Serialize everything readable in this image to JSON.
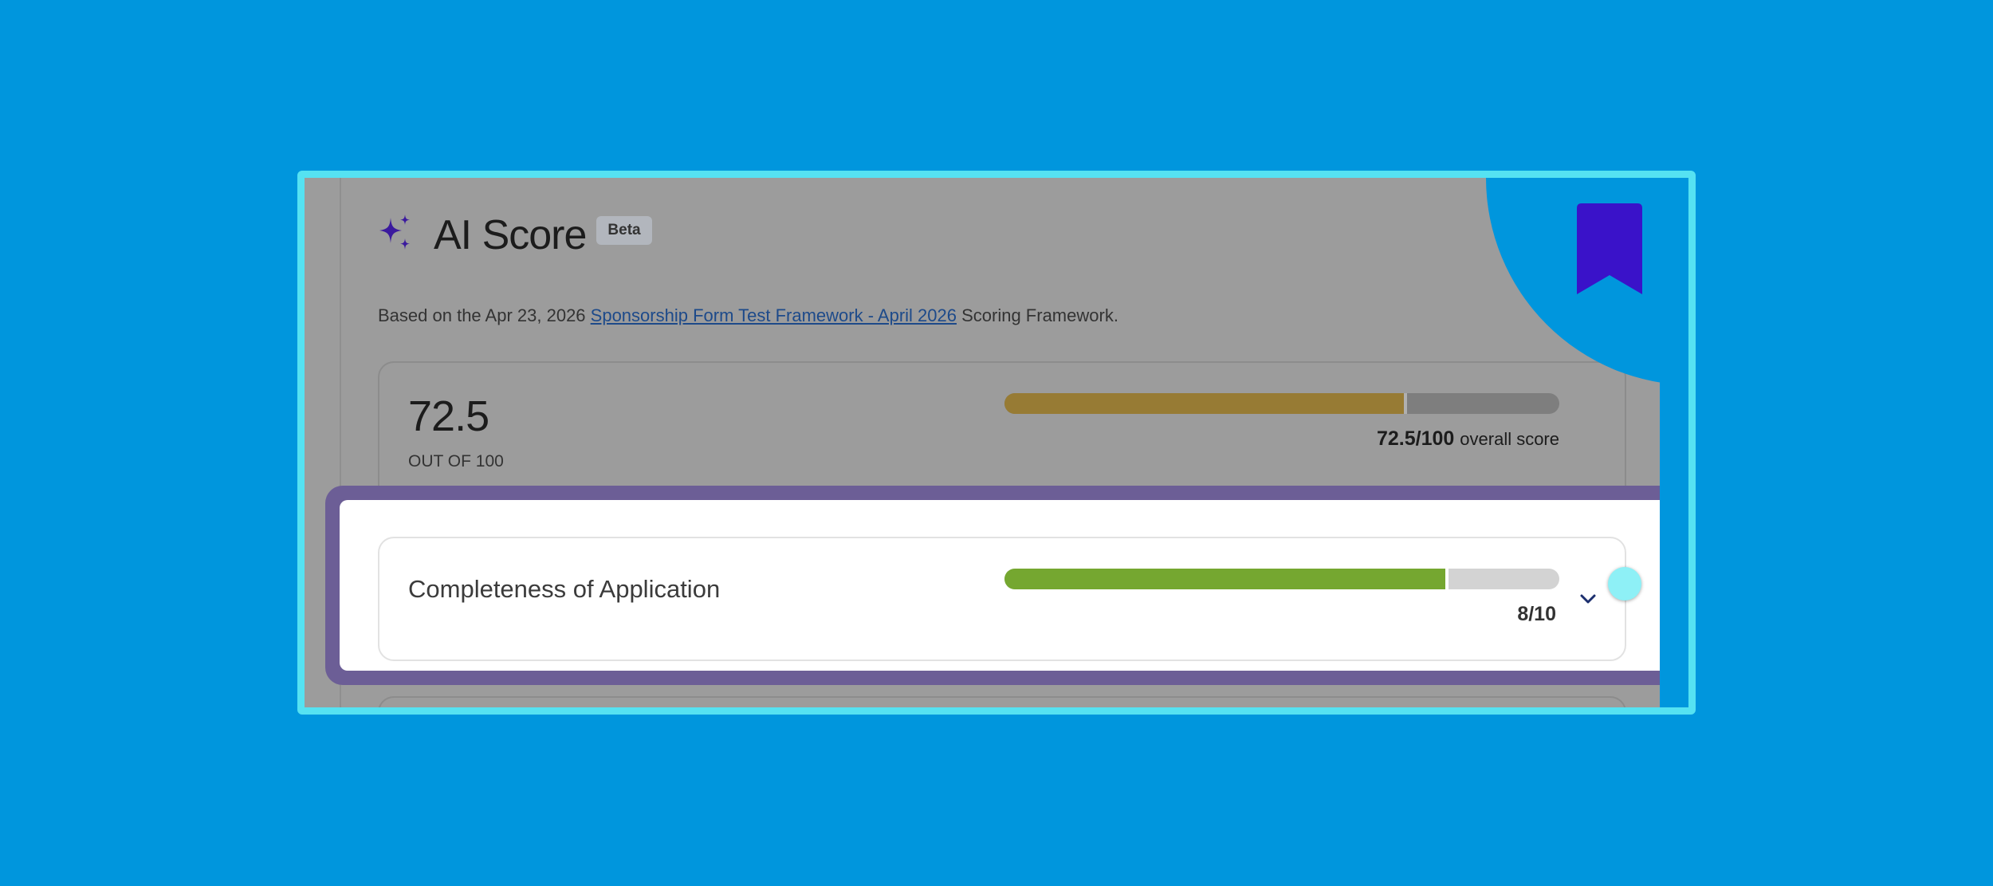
{
  "header": {
    "title": "AI Score",
    "badge": "Beta"
  },
  "subtitle": {
    "prefix": "Based on the Apr 23, 2026 ",
    "link": "Sponsorship Form Test Framework - April 2026",
    "suffix": " Scoring Framework."
  },
  "overall": {
    "score": "72.5",
    "out_of": "OUT OF 100",
    "caption_value": "72.5/100",
    "caption_label": "overall score",
    "fraction": 0.725
  },
  "criterion": {
    "label": "Completeness of Application",
    "score_text": "8/10",
    "fraction": 0.8
  },
  "colors": {
    "background": "#0096dd",
    "frame_border": "#55e2f2",
    "overall_bar": "#977b34",
    "criterion_bar": "#75a730",
    "highlight": "#6c5e96",
    "sparkle": "#3b1a9e",
    "bookmark": "#3a12c9"
  },
  "icons": {
    "sparkle": "sparkle-icon",
    "chevron": "chevron-down-icon",
    "bookmark": "bookmark-icon"
  }
}
